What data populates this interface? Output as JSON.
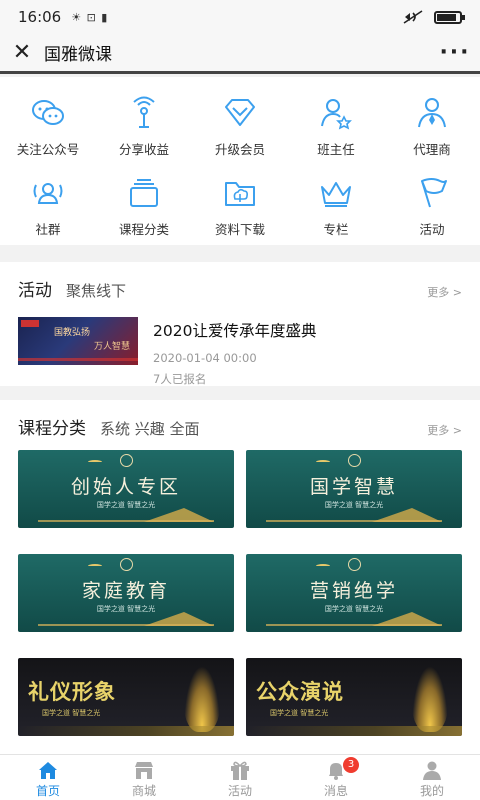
{
  "status_bar": {
    "time": "16:06",
    "extra": "☀ ⊡ ▮"
  },
  "nav": {
    "close_glyph": "✕",
    "title": "国雅微课",
    "more_glyph": "···"
  },
  "menu": {
    "accent_color": "#3ca0ee",
    "items": [
      {
        "label": "关注公众号",
        "icon": "wechat-icon"
      },
      {
        "label": "分享收益",
        "icon": "share-icon"
      },
      {
        "label": "升级会员",
        "icon": "diamond-icon"
      },
      {
        "label": "班主任",
        "icon": "teacher-icon"
      },
      {
        "label": "代理商",
        "icon": "agent-icon"
      },
      {
        "label": "社群",
        "icon": "community-icon"
      },
      {
        "label": "课程分类",
        "icon": "category-icon"
      },
      {
        "label": "资料下载",
        "icon": "download-icon"
      },
      {
        "label": "专栏",
        "icon": "crown-icon"
      },
      {
        "label": "活动",
        "icon": "flag-icon"
      }
    ]
  },
  "activity_section": {
    "title": "活动",
    "subtitle": "聚焦线下",
    "more": "更多 >",
    "event": {
      "title": "2020让爱传承年度盛典",
      "date": "2020-01-04 00:00",
      "registered": "7人已报名",
      "thumb_text_1": "国教弘扬",
      "thumb_text_2": "万人智慧"
    }
  },
  "course_section": {
    "title": "课程分类",
    "subtitle": "系统 兴趣 全面",
    "more": "更多 >",
    "cards": [
      {
        "name": "创始人专区",
        "sub": "国学之道  智慧之光",
        "style": "green"
      },
      {
        "name": "国学智慧",
        "sub": "国学之道  智慧之光",
        "style": "green"
      },
      {
        "name": "家庭教育",
        "sub": "国学之道  智慧之光",
        "style": "green"
      },
      {
        "name": "营销绝学",
        "sub": "国学之道  智慧之光",
        "style": "green"
      },
      {
        "name": "礼仪形象",
        "sub": "国学之道  智慧之光",
        "style": "dark"
      },
      {
        "name": "公众演说",
        "sub": "国学之道  智慧之光",
        "style": "dark"
      }
    ]
  },
  "tabbar": {
    "active_color": "#1e8ae0",
    "tabs": [
      {
        "label": "首页",
        "icon": "home-icon",
        "active": true
      },
      {
        "label": "商城",
        "icon": "shop-icon",
        "active": false
      },
      {
        "label": "活动",
        "icon": "gift-icon",
        "active": false
      },
      {
        "label": "消息",
        "icon": "bell-icon",
        "active": false,
        "badge": "3"
      },
      {
        "label": "我的",
        "icon": "user-icon",
        "active": false
      }
    ]
  }
}
